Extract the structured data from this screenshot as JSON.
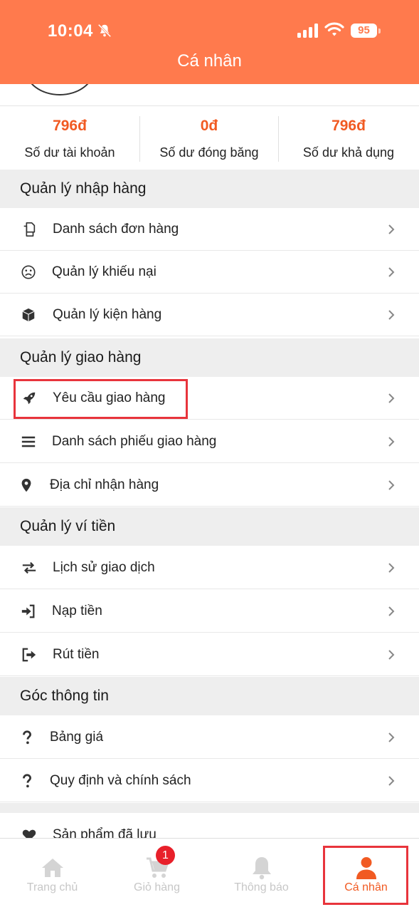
{
  "status_bar": {
    "time": "10:04",
    "battery": "95"
  },
  "header": {
    "title": "Cá nhân"
  },
  "balances": [
    {
      "value": "796đ",
      "label": "Số dư tài khoản"
    },
    {
      "value": "0đ",
      "label": "Số dư đóng băng"
    },
    {
      "value": "796đ",
      "label": "Số dư khả dụng"
    }
  ],
  "sections": [
    {
      "title": "Quản lý nhập hàng",
      "items": [
        {
          "label": "Danh sách đơn hàng",
          "icon": "copy-icon"
        },
        {
          "label": "Quản lý khiếu nại",
          "icon": "frown-icon"
        },
        {
          "label": "Quản lý kiện hàng",
          "icon": "box-icon"
        }
      ]
    },
    {
      "title": "Quản lý giao hàng",
      "items": [
        {
          "label": "Yêu cầu giao hàng",
          "icon": "rocket-icon"
        },
        {
          "label": "Danh sách phiếu giao hàng",
          "icon": "list-icon"
        },
        {
          "label": "Địa chỉ nhận hàng",
          "icon": "map-pin-icon"
        }
      ]
    },
    {
      "title": "Quản lý ví tiền",
      "items": [
        {
          "label": "Lịch sử giao dịch",
          "icon": "exchange-icon"
        },
        {
          "label": "Nạp tiền",
          "icon": "sign-in-icon"
        },
        {
          "label": "Rút tiền",
          "icon": "sign-out-icon"
        }
      ]
    },
    {
      "title": "Góc thông tin",
      "items": [
        {
          "label": "Bảng giá",
          "icon": "question-icon"
        },
        {
          "label": "Quy định và chính sách",
          "icon": "question-icon"
        }
      ]
    }
  ],
  "extra_item": {
    "label": "Sản phẩm đã lưu",
    "icon": "heart-icon"
  },
  "tabbar": {
    "tabs": [
      {
        "label": "Trang chủ",
        "icon": "home-icon"
      },
      {
        "label": "Giỏ hàng",
        "icon": "cart-icon"
      },
      {
        "label": "Thông báo",
        "icon": "bell-icon"
      },
      {
        "label": "Cá nhân",
        "icon": "user-icon"
      }
    ],
    "cart_badge": "1"
  },
  "colors": {
    "header": "#ff7a4d",
    "accent": "#f15a22",
    "highlight": "#e8343c"
  }
}
